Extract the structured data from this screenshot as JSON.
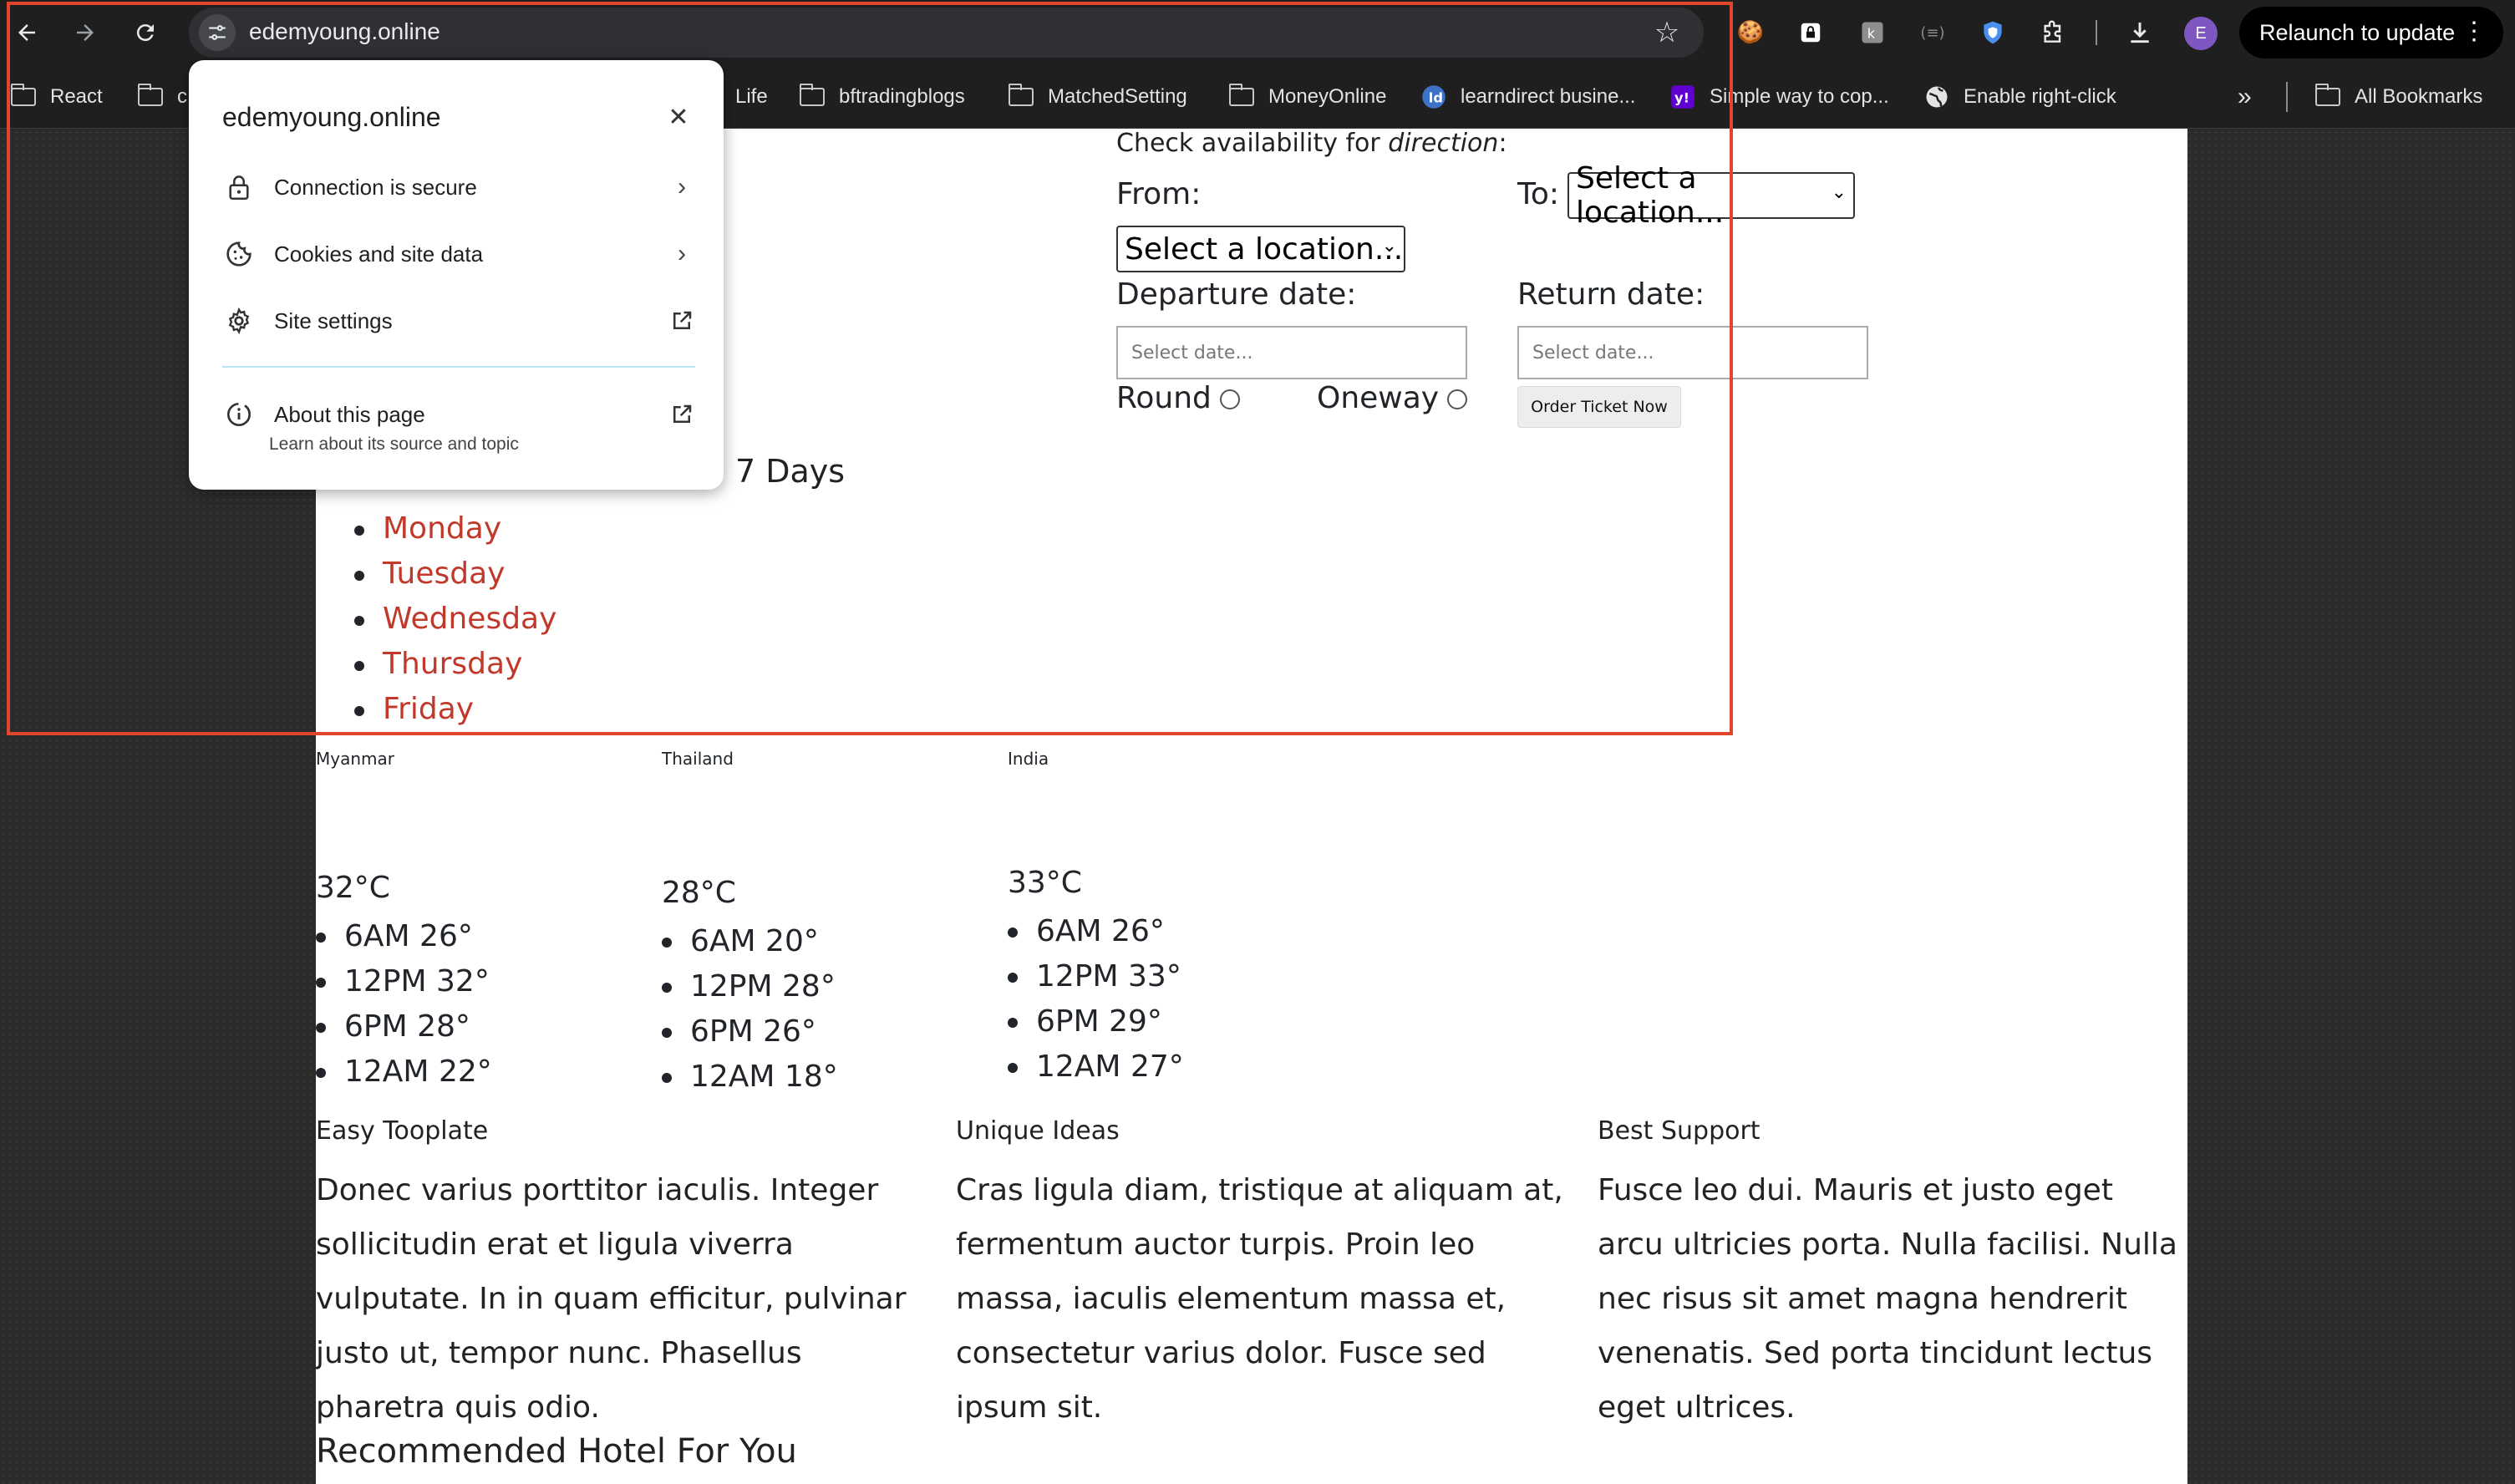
{
  "browser": {
    "url": "edemyoung.online",
    "relaunch_label": "Relaunch to update",
    "profile_initial": "E"
  },
  "bookmarks": [
    {
      "label": "React",
      "icon": "folder-icon"
    },
    {
      "label": "c",
      "icon": "folder-icon"
    },
    {
      "label": "Life",
      "icon": "folder-icon"
    },
    {
      "label": "bftradingblogs",
      "icon": "folder-icon"
    },
    {
      "label": "MatchedSetting",
      "icon": "folder-icon"
    },
    {
      "label": "MoneyOnline",
      "icon": "folder-icon"
    },
    {
      "label": "learndirect busine...",
      "icon": "learndirect-icon"
    },
    {
      "label": "Simple way to cop...",
      "icon": "yahoo-icon"
    },
    {
      "label": "Enable right-click",
      "icon": "globe-icon"
    },
    {
      "label": "All Bookmarks",
      "icon": "folder-icon"
    }
  ],
  "popup": {
    "title": "edemyoung.online",
    "connection": "Connection is secure",
    "cookies": "Cookies and site data",
    "settings": "Site settings",
    "about_title": "About this page",
    "about_sub": "Learn about its source and topic"
  },
  "booking": {
    "check_prefix": "Check availability for ",
    "check_em": "direction",
    "check_suffix": ":",
    "from_label": "From:",
    "to_label": "To:",
    "from_select": "Select a location...",
    "to_select": "Select a location...",
    "departure_label": "Departure date:",
    "return_label": "Return date:",
    "departure_placeholder": "Select date...",
    "return_placeholder": "Select date...",
    "round_label": "Round",
    "oneway_label": "Oneway",
    "order_button": "Order Ticket Now"
  },
  "days_heading_fragment": "7 Days",
  "days": [
    "Monday",
    "Tuesday",
    "Wednesday",
    "Thursday",
    "Friday"
  ],
  "weather": [
    {
      "country": "Myanmar",
      "temp": "32°C",
      "items": [
        "6AM 26°",
        "12PM 32°",
        "6PM 28°",
        "12AM 22°"
      ]
    },
    {
      "country": "Thailand",
      "temp": "28°C",
      "items": [
        "6AM 20°",
        "12PM 28°",
        "6PM 26°",
        "12AM 18°"
      ]
    },
    {
      "country": "India",
      "temp": "33°C",
      "items": [
        "6AM 26°",
        "12PM 33°",
        "6PM 29°",
        "12AM 27°"
      ]
    }
  ],
  "features": [
    {
      "title": "Easy Tooplate",
      "text": "Donec varius porttitor iaculis. Integer sollicitudin erat et ligula viverra vulputate. In in quam efficitur, pulvinar justo ut, tempor nunc. Phasellus pharetra quis odio."
    },
    {
      "title": "Unique Ideas",
      "text": "Cras ligula diam, tristique at aliquam at, fermentum auctor turpis. Proin leo massa, iaculis elementum massa et, consectetur varius dolor. Fusce sed ipsum sit."
    },
    {
      "title": "Best Support",
      "text": "Fusce leo dui. Mauris et justo eget arcu ultricies porta. Nulla facilisi. Nulla nec risus sit amet magna hendrerit venenatis. Sed porta tincidunt lectus eget ultrices."
    }
  ],
  "recommended_heading": "Recommended Hotel For You",
  "colors": {
    "accent_red": "#c0392b",
    "annotation": "#e0452e",
    "chrome_bg": "#1f1f1f"
  }
}
